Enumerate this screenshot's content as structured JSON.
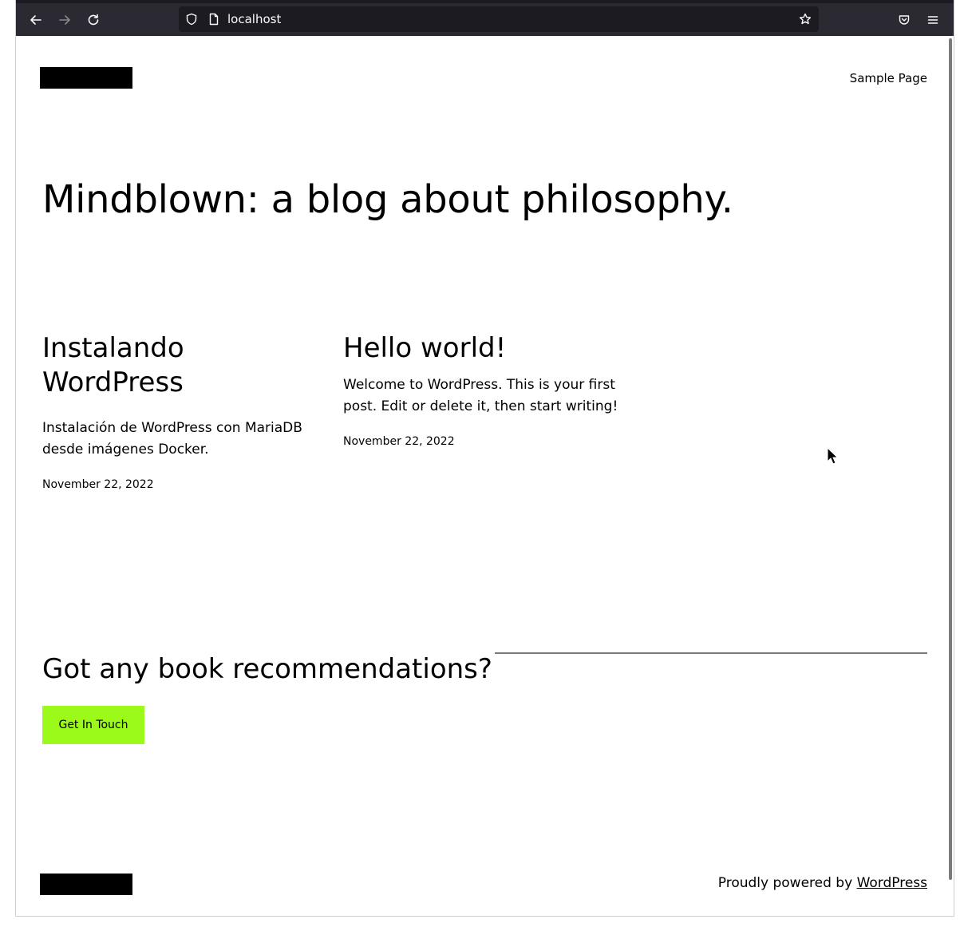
{
  "browser": {
    "url": "localhost",
    "theme_colors": {
      "toolbar": "#2b2a33",
      "urlbar": "#1c1b22",
      "icon": "#fbfbfe"
    },
    "icons": [
      "back-arrow-icon",
      "forward-arrow-icon",
      "reload-icon",
      "shield-icon",
      "page-icon",
      "star-icon",
      "pocket-icon",
      "hamburger-menu-icon"
    ]
  },
  "header": {
    "nav": [
      {
        "label": "Sample Page"
      }
    ]
  },
  "site": {
    "heading": "Mindblown: a blog about philosophy."
  },
  "posts": [
    {
      "title": "Instalando WordPress",
      "excerpt": "Instalación de WordPress con MariaDB desde imágenes Docker.",
      "date": "November 22, 2022"
    },
    {
      "title": "Hello world!",
      "excerpt": "Welcome to WordPress. This is your first post. Edit or delete it, then start writing!",
      "date": "November 22, 2022"
    }
  ],
  "cta": {
    "heading": "Got any book recommendations?",
    "button_label": "Get In Touch",
    "button_color": "#9bfa19"
  },
  "footer": {
    "powered_prefix": "Proudly powered by ",
    "powered_link": "WordPress"
  }
}
